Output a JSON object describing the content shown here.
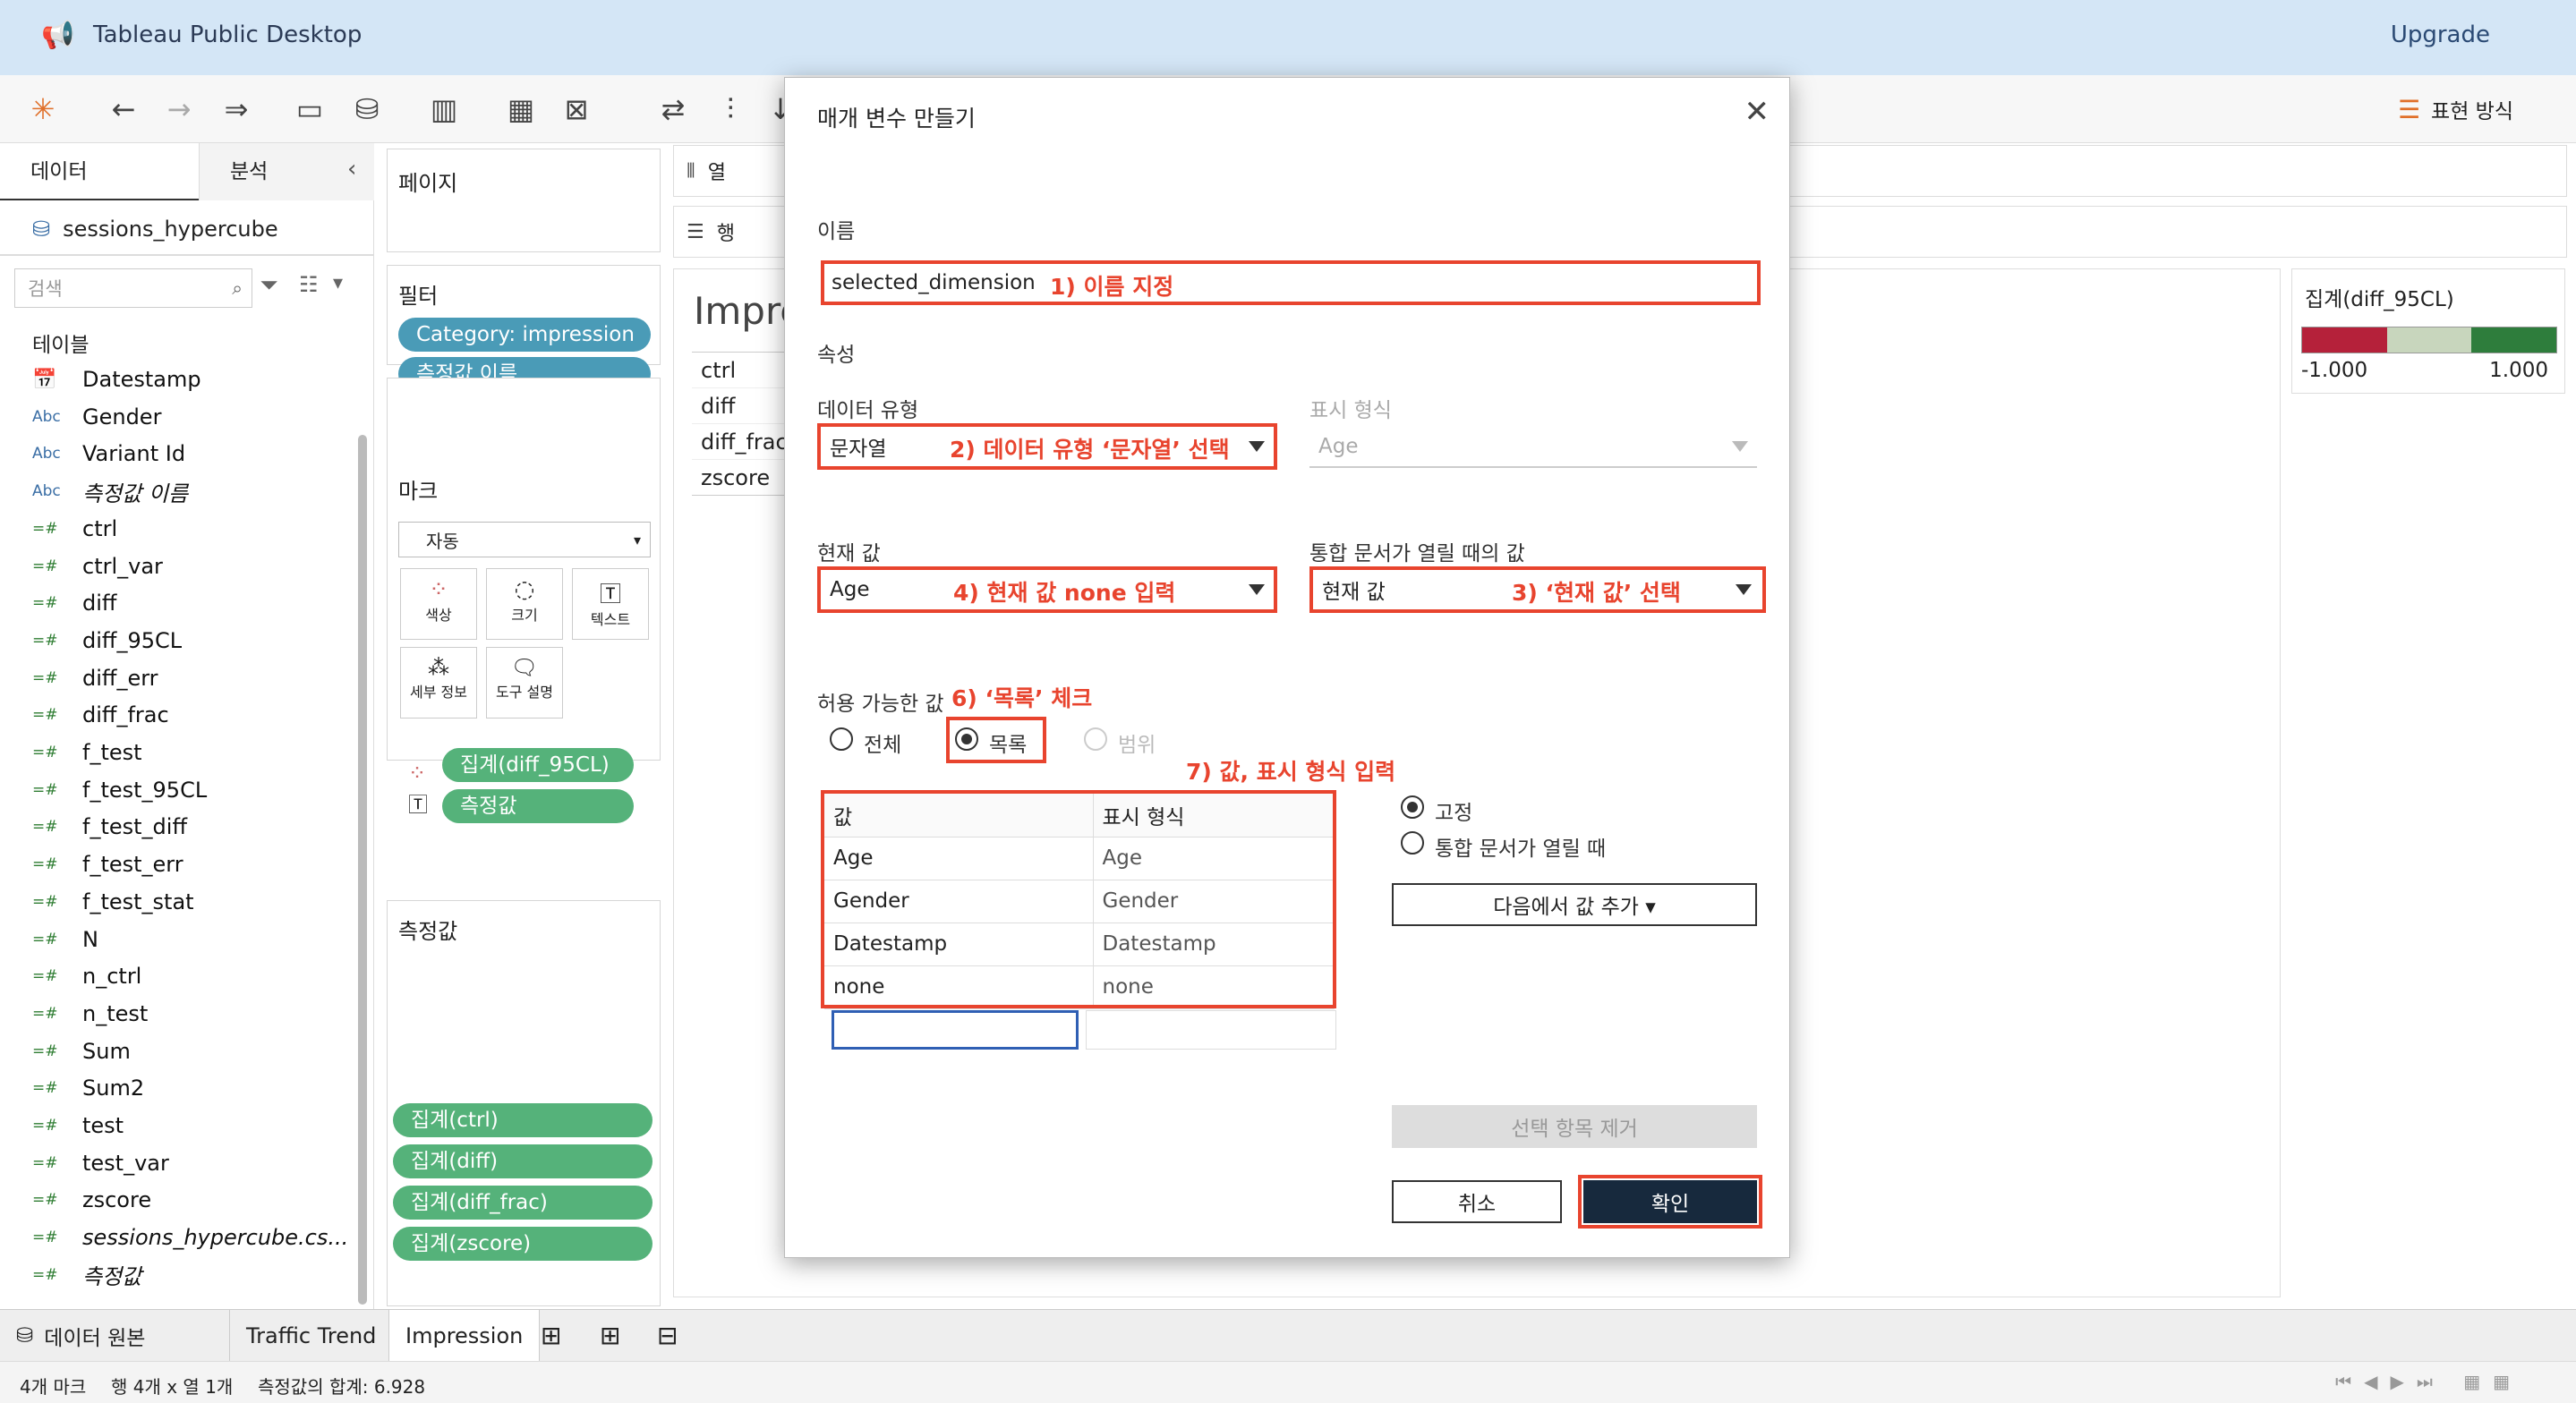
{
  "app": {
    "title": "Tableau Public Desktop",
    "upgrade_label": "Upgrade",
    "show_me_label": "표현 방식"
  },
  "datapane": {
    "tab_data": "데이터",
    "tab_analysis": "분석",
    "datasource": "sessions_hypercube",
    "search_placeholder": "검색",
    "tables_label": "테이블",
    "fields": [
      {
        "icon": "calendar",
        "name": "Datestamp",
        "italic": false
      },
      {
        "icon": "abc",
        "name": "Gender",
        "italic": false
      },
      {
        "icon": "abc",
        "name": "Variant Id",
        "italic": false
      },
      {
        "icon": "abc",
        "name": "측정값 이름",
        "italic": true
      },
      {
        "icon": "measure",
        "name": "ctrl",
        "italic": false
      },
      {
        "icon": "measure",
        "name": "ctrl_var",
        "italic": false
      },
      {
        "icon": "measure",
        "name": "diff",
        "italic": false
      },
      {
        "icon": "measure",
        "name": "diff_95CL",
        "italic": false
      },
      {
        "icon": "measure",
        "name": "diff_err",
        "italic": false
      },
      {
        "icon": "measure",
        "name": "diff_frac",
        "italic": false
      },
      {
        "icon": "measure",
        "name": "f_test",
        "italic": false
      },
      {
        "icon": "measure",
        "name": "f_test_95CL",
        "italic": false
      },
      {
        "icon": "measure",
        "name": "f_test_diff",
        "italic": false
      },
      {
        "icon": "measure",
        "name": "f_test_err",
        "italic": false
      },
      {
        "icon": "measure",
        "name": "f_test_stat",
        "italic": false
      },
      {
        "icon": "measure",
        "name": "N",
        "italic": false
      },
      {
        "icon": "measure",
        "name": "n_ctrl",
        "italic": false
      },
      {
        "icon": "measure",
        "name": "n_test",
        "italic": false
      },
      {
        "icon": "measure",
        "name": "Sum",
        "italic": false
      },
      {
        "icon": "measure",
        "name": "Sum2",
        "italic": false
      },
      {
        "icon": "measure",
        "name": "test",
        "italic": false
      },
      {
        "icon": "measure",
        "name": "test_var",
        "italic": false
      },
      {
        "icon": "measure",
        "name": "zscore",
        "italic": false
      },
      {
        "icon": "measure",
        "name": "sessions_hypercube.cs...",
        "italic": true
      },
      {
        "icon": "measure",
        "name": "측정값",
        "italic": true
      }
    ]
  },
  "shelves": {
    "pages_label": "페이지",
    "filters_label": "필터",
    "filters": [
      "Category: impression",
      "측정값 이름"
    ],
    "marks_label": "마크",
    "mark_type": "자동",
    "mark_buttons": [
      "색상",
      "크기",
      "텍스트",
      "세부 정보",
      "도구 설명"
    ],
    "mark_pills": [
      "집계(diff_95CL)",
      "측정값"
    ],
    "measures_label": "측정값",
    "measure_pills": [
      "집계(ctrl)",
      "집계(diff)",
      "집계(diff_frac)",
      "집계(zscore)"
    ],
    "columns_label": "열",
    "rows_label": "행"
  },
  "view": {
    "title_partial": "Impre",
    "rows": [
      "ctrl",
      "diff",
      "diff_frac",
      "zscore"
    ]
  },
  "legend": {
    "title": "집계(diff_95CL)",
    "min": "-1.000",
    "max": "1.000",
    "colors": [
      "#b5213a",
      "#c8d6bd",
      "#2e7d3c"
    ]
  },
  "bottom": {
    "datasource_tab": "데이터 원본",
    "sheets": [
      "Traffic Trend",
      "Impression"
    ],
    "status_marks": "4개 마크",
    "status_rows": "행 4개 x 열 1개",
    "status_sum": "측정값의 합계: 6.928"
  },
  "dialog": {
    "title": "매개 변수 만들기",
    "name_label": "이름",
    "name_value": "selected_dimension",
    "props_label": "속성",
    "datatype_label": "데이터 유형",
    "datatype_value": "문자열",
    "display_format_label": "표시 형식",
    "display_format_value": "Age",
    "current_value_label": "현재 값",
    "current_value": "Age",
    "on_open_label": "통합 문서가 열릴 때의 값",
    "on_open_value": "현재 값",
    "allowable_label": "허용 가능한 값",
    "radio_all": "전체",
    "radio_list": "목록",
    "radio_range": "범위",
    "table_headers": [
      "값",
      "표시 형식"
    ],
    "table_rows": [
      [
        "Age",
        "Age"
      ],
      [
        "Gender",
        "Gender"
      ],
      [
        "Datestamp",
        "Datestamp"
      ],
      [
        "none",
        "none"
      ]
    ],
    "opt_fixed": "고정",
    "opt_on_open": "통합 문서가 열릴 때",
    "add_from_label": "다음에서 값 추가 ▾",
    "remove_label": "선택 항목 제거",
    "cancel_label": "취소",
    "ok_label": "확인",
    "annotations": {
      "a1": "1) 이름 지정",
      "a2": "2) 데이터 유형 ‘문자열’ 선택",
      "a3": "3) ‘현재 값’ 선택",
      "a4": "4) 현재 값 none 입력",
      "a6": "6) ‘목록’ 체크",
      "a7": "7) 값, 표시 형식 입력"
    }
  }
}
